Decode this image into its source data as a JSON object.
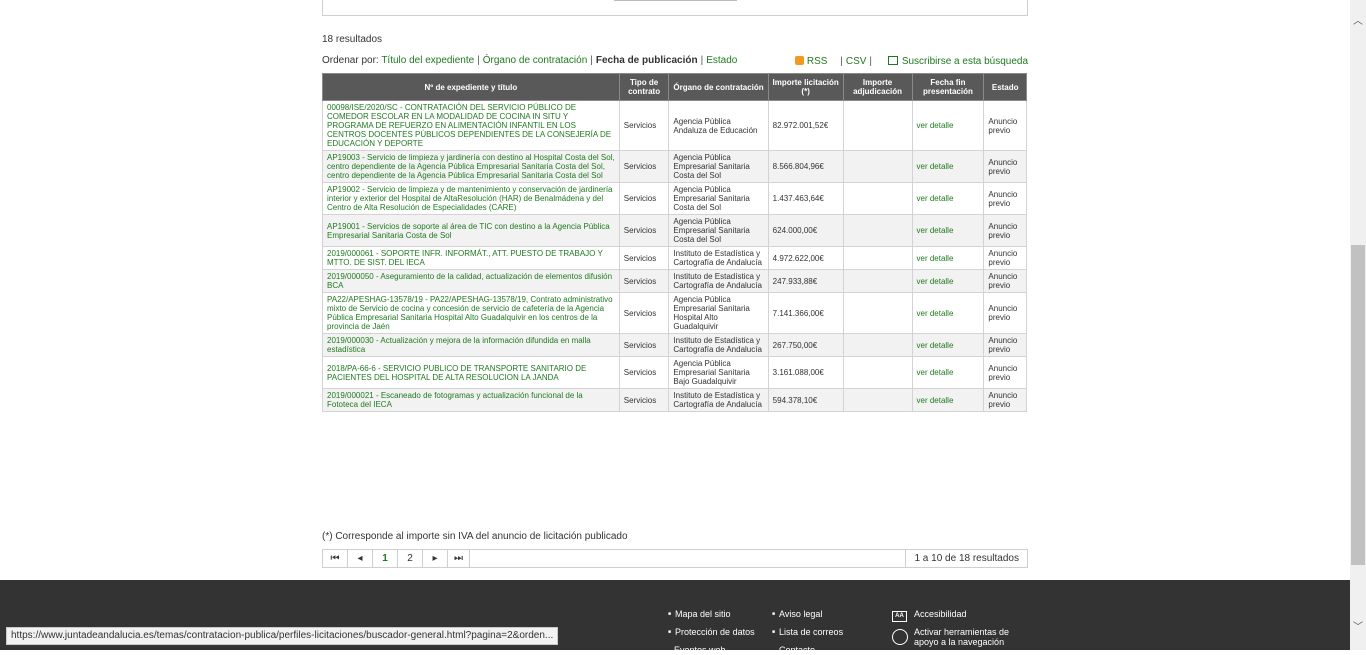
{
  "results_count": "18 resultados",
  "sort": {
    "label": "Ordenar por:",
    "options": [
      "Título del expediente",
      "Órgano de contratación",
      "Fecha de publicación",
      "Estado"
    ],
    "rss": "RSS",
    "csv": "CSV",
    "subscribe": "Suscribirse a esta búsqueda"
  },
  "table": {
    "headers": [
      "Nº de expediente y título",
      "Tipo de contrato",
      "Órgano de contratación",
      "Importe licitación (*)",
      "Importe adjudicación",
      "Fecha fin presentación",
      "Estado"
    ],
    "rows": [
      {
        "title": "00098/ISE/2020/SC - CONTRATACIÓN DEL SERVICIO PÚBLICO DE COMEDOR ESCOLAR EN LA MODALIDAD DE COCINA IN SITU Y PROGRAMA DE REFUERZO EN ALIMENTACIÓN INFANTIL EN LOS CENTROS DOCENTES PÚBLICOS DEPENDIENTES DE LA CONSEJERÍA DE EDUCACIÓN Y DEPORTE",
        "tipo": "Servicios",
        "organo": "Agencia Pública Andaluza de Educación",
        "importe": "82.972.001,52€",
        "adjudicacion": "",
        "fecha": "ver detalle",
        "estado": "Anuncio previo"
      },
      {
        "title": "AP19003 - Servicio de limpieza y jardinería con destino al Hospital Costa del Sol, centro dependiente de la Agencia Pública Empresarial Sanitaria Costa del Sol, centro dependiente de la Agencia Pública Empresarial Sanitaria Costa del Sol",
        "tipo": "Servicios",
        "organo": "Agencia Pública Empresarial Sanitaria Costa del Sol",
        "importe": "8.566.804,96€",
        "adjudicacion": "",
        "fecha": "ver detalle",
        "estado": "Anuncio previo"
      },
      {
        "title": "AP19002 - Servicio de limpieza y de mantenimiento y conservación de jardinería interior y exterior del Hospital de AltaResolución (HAR) de Benalmádena y del Centro de Alta Resolución de Especialidades (CARE)",
        "tipo": "Servicios",
        "organo": "Agencia Pública Empresarial Sanitaria Costa del Sol",
        "importe": "1.437.463,64€",
        "adjudicacion": "",
        "fecha": "ver detalle",
        "estado": "Anuncio previo"
      },
      {
        "title": "AP19001 - Servicios de soporte al área de TIC con destino a la Agencia Pública Empresarial Sanitaria Costa de Sol",
        "tipo": "Servicios",
        "organo": "Agencia Pública Empresarial Sanitaria Costa del Sol",
        "importe": "624.000,00€",
        "adjudicacion": "",
        "fecha": "ver detalle",
        "estado": "Anuncio previo"
      },
      {
        "title": "2019/000061 - SOPORTE INFR. INFORMÁT., ATT. PUESTO DE TRABAJO Y MTTO. DE SIST. DEL IECA",
        "tipo": "Servicios",
        "organo": "Instituto de Estadística y Cartografía de Andalucía",
        "importe": "4.972.622,00€",
        "adjudicacion": "",
        "fecha": "ver detalle",
        "estado": "Anuncio previo"
      },
      {
        "title": "2019/000050 - Aseguramiento de la calidad, actualización de elementos difusión BCA",
        "tipo": "Servicios",
        "organo": "Instituto de Estadística y Cartografía de Andalucía",
        "importe": "247.933,88€",
        "adjudicacion": "",
        "fecha": "ver detalle",
        "estado": "Anuncio previo"
      },
      {
        "title": "PA22/APESHAG-13578/19 - PA22/APESHAG-13578/19, Contrato administrativo mixto de Servicio de cocina y concesión de servicio de cafetería de la Agencia Pública Empresarial Sanitaria Hospital Alto Guadalquivir en los centros de la provincia de Jaén",
        "tipo": "Servicios",
        "organo": "Agencia Pública Empresarial Sanitaria Hospital Alto Guadalquivir",
        "importe": "7.141.366,00€",
        "adjudicacion": "",
        "fecha": "ver detalle",
        "estado": "Anuncio previo"
      },
      {
        "title": "2019/000030 - Actualización y mejora de la información difundida en malla estadística",
        "tipo": "Servicios",
        "organo": "Instituto de Estadística y Cartografía de Andalucía",
        "importe": "267.750,00€",
        "adjudicacion": "",
        "fecha": "ver detalle",
        "estado": "Anuncio previo"
      },
      {
        "title": "2018/PA-66-6 - SERVICIO PUBLICO DE TRANSPORTE SANITARIO DE PACIENTES DEL HOSPITAL DE ALTA RESOLUCION LA JANDA",
        "tipo": "Servicios",
        "organo": "Agencia Pública Empresarial Sanitaria Bajo Guadalquivir",
        "importe": "3.161.088,00€",
        "adjudicacion": "",
        "fecha": "ver detalle",
        "estado": "Anuncio previo"
      },
      {
        "title": "2019/000021 - Escaneado de fotogramas y actualización funcional de la Fototeca del IECA",
        "tipo": "Servicios",
        "organo": "Instituto de Estadística y Cartografía de Andalucía",
        "importe": "594.378,10€",
        "adjudicacion": "",
        "fecha": "ver detalle",
        "estado": "Anuncio previo"
      }
    ]
  },
  "footnote": "(*) Corresponde al importe sin IVA del anuncio de licitación publicado",
  "pagination": {
    "first": "⏮",
    "prev": "◂",
    "pages": [
      "1",
      "2"
    ],
    "next": "▸",
    "last": "⏭",
    "summary": "1 a 10 de 18 resultados"
  },
  "footer": {
    "links": [
      "Mapa del sitio",
      "Protección de datos",
      "Aviso legal",
      "Lista de correos",
      "Accesibilidad",
      "Activar herramientas de apoyo a la navegación"
    ],
    "partial": [
      "Eventos web",
      "Contacto"
    ]
  },
  "status_url": "https://www.juntadeandalucia.es/temas/contratacion-publica/perfiles-licitaciones/buscador-general.html?pagina=2&orden..."
}
